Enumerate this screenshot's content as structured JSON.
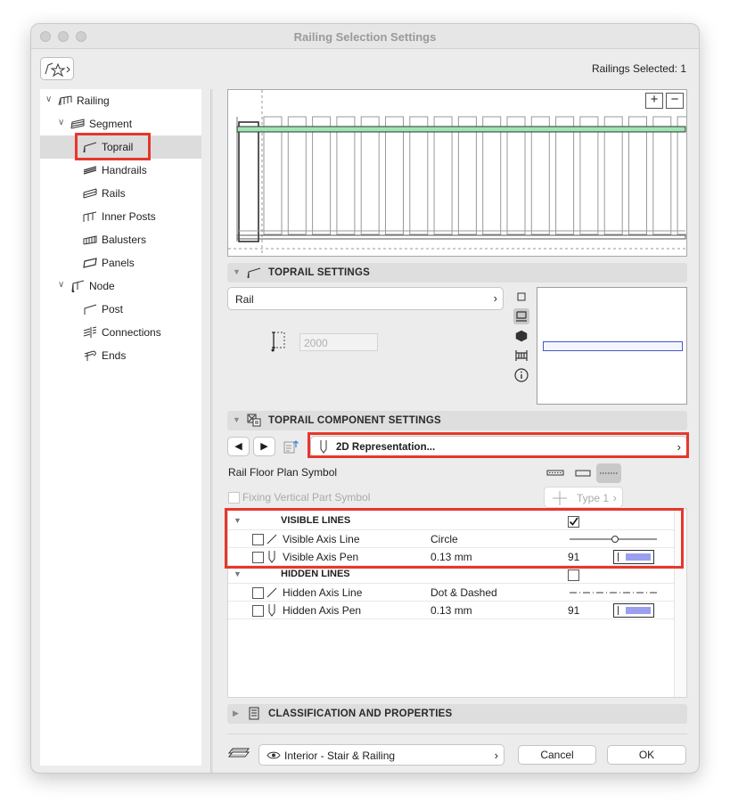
{
  "window": {
    "title": "Railing Selection Settings"
  },
  "header": {
    "selection_count": "Railings Selected: 1"
  },
  "tree": {
    "items": [
      {
        "label": "Railing"
      },
      {
        "label": "Segment"
      },
      {
        "label": "Toprail"
      },
      {
        "label": "Handrails"
      },
      {
        "label": "Rails"
      },
      {
        "label": "Inner Posts"
      },
      {
        "label": "Balusters"
      },
      {
        "label": "Panels"
      },
      {
        "label": "Node"
      },
      {
        "label": "Post"
      },
      {
        "label": "Connections"
      },
      {
        "label": "Ends"
      }
    ],
    "selected": "Toprail"
  },
  "preview": {
    "zoom_in": "+",
    "zoom_out": "−",
    "highlight_color": "#9ee6b4"
  },
  "toprail_settings": {
    "title": "TOPRAIL SETTINGS",
    "profile": "Rail",
    "height_value": "2000"
  },
  "component_settings": {
    "title": "TOPRAIL COMPONENT SETTINGS",
    "page": "2D Representation...",
    "floor_plan_symbol_label": "Rail Floor Plan Symbol",
    "fixing_label": "Fixing Vertical Part Symbol",
    "type_label": "Type 1"
  },
  "table": {
    "groups": [
      {
        "title": "VISIBLE LINES",
        "checked": true,
        "rows": [
          {
            "name": "Visible Axis Line",
            "value": "Circle",
            "pen": ""
          },
          {
            "name": "Visible Axis Pen",
            "value": "0.13 mm",
            "pen": "91"
          }
        ]
      },
      {
        "title": "HIDDEN LINES",
        "checked": false,
        "rows": [
          {
            "name": "Hidden Axis Line",
            "value": "Dot & Dashed",
            "pen": ""
          },
          {
            "name": "Hidden Axis Pen",
            "value": "0.13 mm",
            "pen": "91"
          }
        ]
      }
    ]
  },
  "classification": {
    "title": "CLASSIFICATION AND PROPERTIES"
  },
  "footer": {
    "layer": "Interior - Stair & Railing",
    "cancel": "Cancel",
    "ok": "OK"
  },
  "colors": {
    "highlight_red": "#e6372c",
    "pen_swatch": "#9a9ff0",
    "accent_green": "#9ee6b4"
  }
}
